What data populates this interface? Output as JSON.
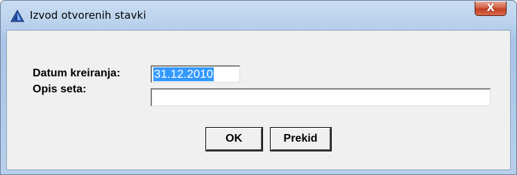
{
  "window": {
    "title": "Izvod otvorenih stavki",
    "close_label": "X",
    "icon": "app-triangle-icon"
  },
  "form": {
    "datum_label": "Datum kreiranja:",
    "datum_value": "31.12.2010",
    "opis_label": "Opis seta:",
    "opis_value": ""
  },
  "buttons": {
    "ok_label": "OK",
    "cancel_label": "Prekid"
  },
  "colors": {
    "selection": "#3399ff",
    "close_button": "#c23d22",
    "client_bg": "#f0f0f0"
  }
}
